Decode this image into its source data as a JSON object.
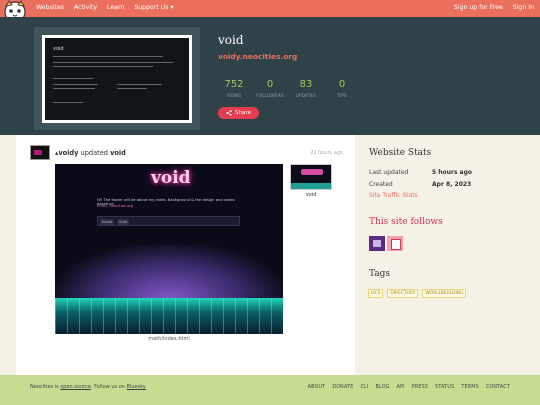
{
  "nav": {
    "left": [
      "Websites",
      "Activity",
      "Learn",
      "Support Us"
    ],
    "right": [
      "Sign up for Free",
      "Sign In"
    ]
  },
  "site": {
    "name": "void",
    "url": "voidy.neocities.org",
    "stats": [
      {
        "value": "752",
        "label": "VIEWS"
      },
      {
        "value": "0",
        "label": "FOLLOWERS"
      },
      {
        "value": "83",
        "label": "UPDATES"
      },
      {
        "value": "0",
        "label": "TIPS"
      }
    ],
    "share_label": "Share"
  },
  "event": {
    "user": "voidy",
    "verb": "updated",
    "site": "void",
    "time": "22 hours ago",
    "screenshot_title": "void",
    "screenshot_text": "Hi! The footer will be about my index. Background & the design and codes based on",
    "screenshot_link": "Rinks, neocities.org",
    "screenshot_tabs": [
      "home",
      "links"
    ],
    "file_label": "math/index.html",
    "small_label": "void"
  },
  "sidebar": {
    "stats_heading": "Website Stats",
    "last_updated_label": "Last updated",
    "last_updated_value": "5 hours ago",
    "created_label": "Created",
    "created_value": "Apr 8, 2023",
    "traffic_link": "Site Traffic Stats",
    "follows_heading": "This site follows",
    "tags_heading": "Tags",
    "tags": [
      "OCS",
      "DIRECTORY",
      "WORLDBUILDING"
    ]
  },
  "footer": {
    "text_a": "Neocities is",
    "source_link": "open source",
    "text_b": ". Follow us on",
    "bluesky_link": "Bluesky",
    "links": [
      "ABOUT",
      "DONATE",
      "CLI",
      "BLOG",
      "API",
      "PRESS",
      "STATUS",
      "TERMS",
      "CONTACT"
    ]
  },
  "colors": {
    "nav": "#eb6f5d",
    "header": "#2f4149",
    "accent_green": "#a5c85a",
    "share": "#e63c4f",
    "footer": "#c6dd91"
  }
}
